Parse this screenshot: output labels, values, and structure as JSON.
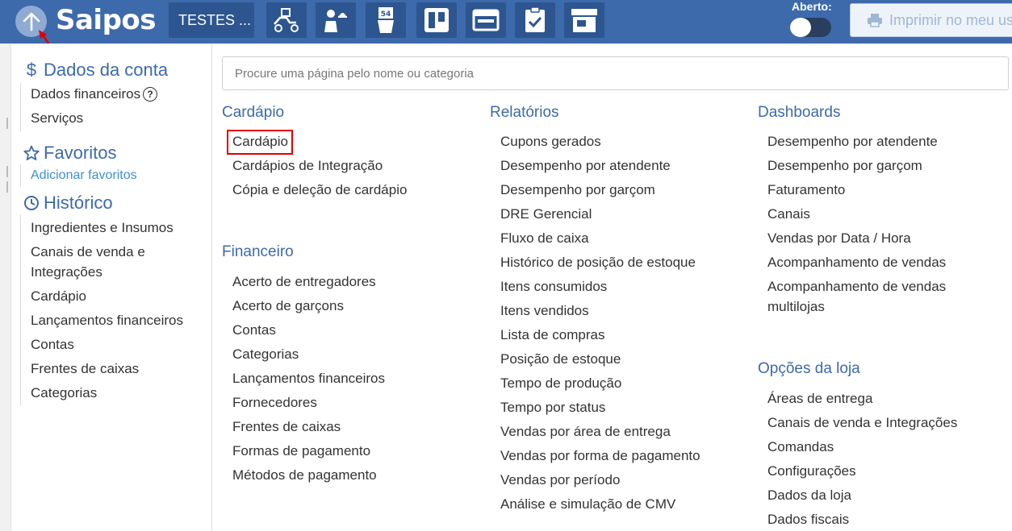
{
  "header": {
    "logo": "Saipos",
    "store_name": "TESTES ...",
    "status_label": "Aberto:",
    "print_label": "Imprimir no meu usuário",
    "tools": [
      "delivery-icon",
      "waiter-icon",
      "table-number-icon",
      "kanban-board-icon",
      "card-layout-icon",
      "clipboard-check-icon",
      "store-icon"
    ]
  },
  "sidebar": {
    "account": {
      "title": "Dados da conta",
      "items": [
        "Dados financeiros",
        "Serviços"
      ]
    },
    "favorites": {
      "title": "Favoritos",
      "add_label": "Adicionar favoritos"
    },
    "history": {
      "title": "Histórico",
      "items": [
        "Ingredientes e Insumos",
        "Canais de venda e",
        "Integrações",
        "Cardápio",
        "Lançamentos financeiros",
        "Contas",
        "Frentes de caixas",
        "Categorias"
      ]
    }
  },
  "search": {
    "placeholder": "Procure uma página pelo nome ou categoria"
  },
  "menu": {
    "cardapio": {
      "title": "Cardápio",
      "items": [
        "Cardápio",
        "Cardápios de Integração",
        "Cópia e deleção de cardápio"
      ]
    },
    "financeiro": {
      "title": "Financeiro",
      "items": [
        "Acerto de entregadores",
        "Acerto de garçons",
        "Contas",
        "Categorias",
        "Lançamentos financeiros",
        "Fornecedores",
        "Frentes de caixas",
        "Formas de pagamento",
        "Métodos de pagamento"
      ]
    },
    "relatorios": {
      "title": "Relatórios",
      "items": [
        "Cupons gerados",
        "Desempenho por atendente",
        "Desempenho por garçom",
        "DRE Gerencial",
        "Fluxo de caixa",
        "Histórico de posição de estoque",
        "Itens consumidos",
        "Itens vendidos",
        "Lista de compras",
        "Posição de estoque",
        "Tempo de produção",
        "Tempo por status",
        "Vendas por área de entrega",
        "Vendas por forma de pagamento",
        "Vendas por período",
        "Análise e simulação de CMV"
      ]
    },
    "dashboards": {
      "title": "Dashboards",
      "items": [
        "Desempenho por atendente",
        "Desempenho por garçom",
        "Faturamento",
        "Canais",
        "Vendas por Data / Hora",
        "Acompanhamento de vendas",
        "Acompanhamento de vendas",
        "multilojas"
      ]
    },
    "opcoes": {
      "title": "Opções da loja",
      "items": [
        "Áreas de entrega",
        "Canais de venda e Integrações",
        "Comandas",
        "Configurações",
        "Dados da loja",
        "Dados fiscais"
      ]
    }
  },
  "colors": {
    "header_bg": "#3d6aab",
    "accent": "#3d6aab",
    "link": "#3d8fd1",
    "highlight": "#e00000"
  }
}
